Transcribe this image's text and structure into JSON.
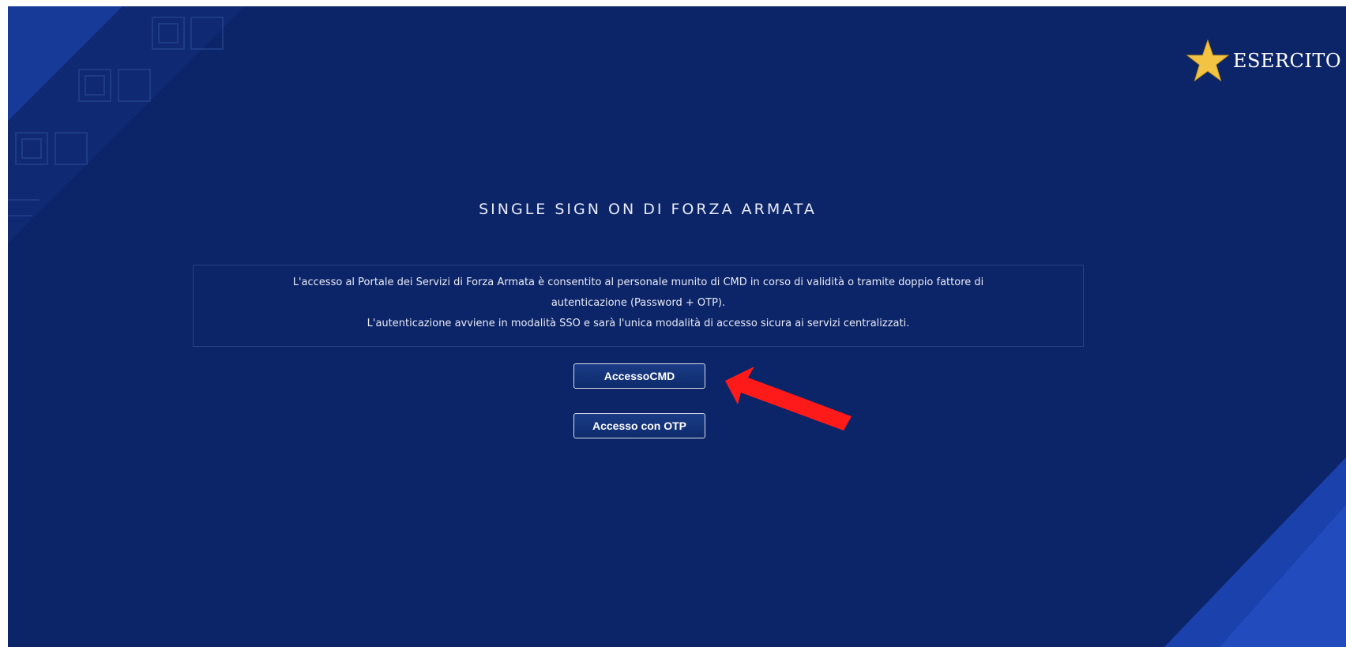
{
  "brand": {
    "name": "ESERCITO",
    "icon": "star-icon",
    "star_color": "#f3c443"
  },
  "page": {
    "title": "SINGLE SIGN ON DI FORZA ARMATA",
    "background_color": "#0c2468",
    "accent_color": "#1d46b8"
  },
  "info": {
    "line1": "L'accesso al Portale dei Servizi di Forza Armata è consentito al personale munito di CMD in corso di validità o tramite doppio fattore di",
    "line2": "autenticazione (Password + OTP).",
    "line3": "L'autenticazione avviene in modalità SSO e sarà l'unica modalità di accesso sicura ai servizi centralizzati."
  },
  "buttons": {
    "cmd_label": "AccessoCMD",
    "otp_label": "Accesso con OTP"
  },
  "annotation": {
    "icon": "red-arrow-icon",
    "color": "#ff1a1a"
  }
}
